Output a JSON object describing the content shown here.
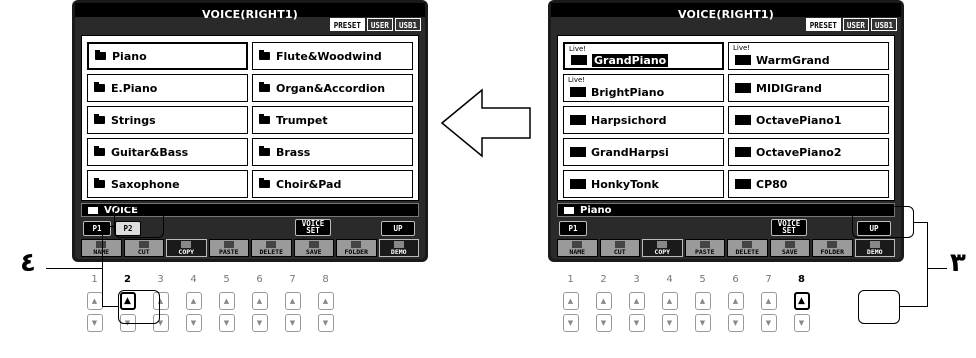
{
  "left_screen": {
    "title": "VOICE(RIGHT1)",
    "tabs": [
      "PRESET",
      "USER",
      "USB1"
    ],
    "items": [
      "Piano",
      "Flute&Woodwind",
      "E.Piano",
      "Organ&Accordion",
      "Strings",
      "Trumpet",
      "Guitar&Bass",
      "Brass",
      "Saxophone",
      "Choir&Pad"
    ],
    "path": "VOICE",
    "page_buttons": [
      "P1",
      "P2"
    ],
    "voice_set": "VOICE\nSET",
    "up": "UP",
    "func_buttons": [
      "NAME",
      "CUT",
      "COPY",
      "PASTE",
      "DELETE",
      "SAVE",
      "FOLDER",
      "DEMO"
    ]
  },
  "right_screen": {
    "title": "VOICE(RIGHT1)",
    "tabs": [
      "PRESET",
      "USER",
      "USB1"
    ],
    "live_label": "Live!",
    "items": [
      "GrandPiano",
      "WarmGrand",
      "BrightPiano",
      "MIDIGrand",
      "Harpsichord",
      "OctavePiano1",
      "GrandHarpsi",
      "OctavePiano2",
      "HonkyTonk",
      "CP80"
    ],
    "path": "Piano",
    "page_buttons": [
      "P1"
    ],
    "voice_set": "VOICE\nSET",
    "up": "UP",
    "func_buttons": [
      "NAME",
      "CUT",
      "COPY",
      "PASTE",
      "DELETE",
      "SAVE",
      "FOLDER",
      "DEMO"
    ]
  },
  "button_numbers": [
    "1",
    "2",
    "3",
    "4",
    "5",
    "6",
    "7",
    "8"
  ],
  "key_symbols": {
    "up": "▲",
    "down": "▼"
  },
  "callouts": {
    "left": "٤",
    "right": "٣"
  }
}
